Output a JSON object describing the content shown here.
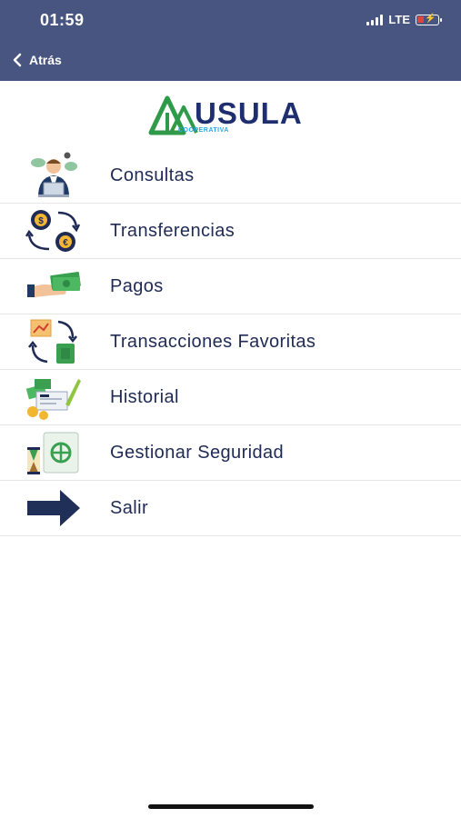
{
  "status_bar": {
    "time": "01:59",
    "network": "LTE"
  },
  "nav": {
    "back_label": "Atrás"
  },
  "logo": {
    "brand": "USULA",
    "tagline": "COOPERATIVA"
  },
  "menu": {
    "items": [
      {
        "label": "Consultas",
        "icon": "consultant-laptop-icon"
      },
      {
        "label": "Transferencias",
        "icon": "coin-exchange-icon"
      },
      {
        "label": "Pagos",
        "icon": "cash-payment-icon"
      },
      {
        "label": "Transacciones Favoritas",
        "icon": "favorite-transactions-icon"
      },
      {
        "label": "Historial",
        "icon": "check-history-icon"
      },
      {
        "label": "Gestionar Seguridad",
        "icon": "security-safe-icon"
      },
      {
        "label": "Salir",
        "icon": "exit-arrow-icon"
      }
    ]
  },
  "colors": {
    "header": "#485581",
    "text": "#1f2a55",
    "brand_green": "#2e9a4a",
    "brand_blue": "#1e2e6e"
  }
}
